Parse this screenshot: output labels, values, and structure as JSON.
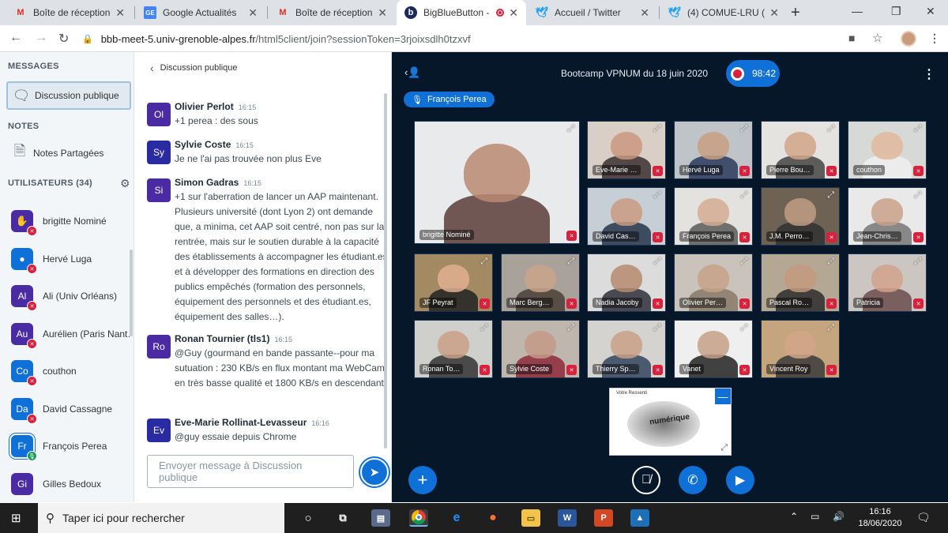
{
  "browser": {
    "tabs": [
      {
        "label": "Boîte de réception (2",
        "icon": "gmail-icon",
        "active": false
      },
      {
        "label": "Google Actualités",
        "icon": "google-news-icon",
        "active": false
      },
      {
        "label": "Boîte de réception (9",
        "icon": "gmail-icon",
        "active": false
      },
      {
        "label": "BigBlueButton -",
        "icon": "bigbluebutton-icon",
        "active": true
      },
      {
        "label": "Accueil / Twitter",
        "icon": "twitter-icon",
        "active": false
      },
      {
        "label": "(4) COMUE-LRU (@C",
        "icon": "twitter-icon",
        "active": false
      }
    ],
    "url_host": "bbb-meet-5.univ-grenoble-alpes.fr",
    "url_path": "/html5client/join?sessionToken=3rjoixsdlh0tzxvf"
  },
  "sidebar": {
    "messages_heading": "MESSAGES",
    "public_chat_label": "Discussion publique",
    "notes_heading": "NOTES",
    "shared_notes_label": "Notes Partagées",
    "users_heading": "UTILISATEURS (34)",
    "users": [
      {
        "initials": "",
        "name": "brigitte Nominé",
        "color": "#4a2ba3",
        "icon": "hand-icon"
      },
      {
        "initials": "",
        "name": "Hervé Luga",
        "color": "#0f70d7",
        "icon": "user-icon"
      },
      {
        "initials": "Al",
        "name": "Ali (Univ Orléans)",
        "color": "#4a2ba3"
      },
      {
        "initials": "Au",
        "name": "Aurélien (Paris Nant…",
        "color": "#4a2ba3"
      },
      {
        "initials": "Co",
        "name": "couthon",
        "color": "#0f70d7"
      },
      {
        "initials": "Da",
        "name": "David Cassagne",
        "color": "#0f70d7"
      },
      {
        "initials": "Fr",
        "name": "François Perea",
        "color": "#0f70d7"
      },
      {
        "initials": "Gi",
        "name": "Gilles Bedoux",
        "color": "#4a2ba3"
      }
    ]
  },
  "chat": {
    "title": "Discussion publique",
    "messages": [
      {
        "initials": "Ol",
        "color": "#4a2ba3",
        "name": "Olivier Perlot",
        "time": "16:15",
        "text": "+1 perea : des sous"
      },
      {
        "initials": "Sy",
        "color": "#2a2ba3",
        "name": "Sylvie Coste",
        "time": "16:15",
        "text": "Je ne l'ai pas trouvée non plus Eve"
      },
      {
        "initials": "Si",
        "color": "#4a2ba3",
        "name": "Simon Gadras",
        "time": "16:15",
        "text": "+1 sur l'aberration de lancer un AAP maintenant. Plusieurs université (dont Lyon 2) ont demande que, a minima, cet AAP soit centré, non pas sur la rentrée, mais sur le soutien durable à la capacité des établissements à accompagner les étudiant.es et à développer des formations en direction des publics empêchés (formation des personnels, équipement des personnels et des étudiant.es, équipement des salles…)."
      },
      {
        "initials": "Ro",
        "color": "#4a2ba3",
        "name": "Ronan Tournier (tls1)",
        "time": "16:15",
        "text": "@Guy (gourmand en bande passante--pour ma sutuation : 230 KB/s en flux montant ma WebCam en très basse qualité et 1800 KB/s en descendant)"
      },
      {
        "initials": "Ev",
        "color": "#2a2ba3",
        "name": "Eve-Marie Rollinat-Levasseur",
        "time": "16:16",
        "text": "@guy essaie depuis Chrome"
      }
    ],
    "input_placeholder": "Envoyer message à Discussion publique"
  },
  "meeting": {
    "title": "Bootcamp VPNUM du 18 juin 2020",
    "recording_time": "98:42",
    "talking_indicator": "François Perea",
    "videos": [
      {
        "name": "brigitte Nominé",
        "bg": "#e9eaec",
        "skin": "#b98a72",
        "shirt": "#5b3d3a"
      },
      {
        "name": "Eve-Marie …",
        "bg": "#d9cfc6",
        "skin": "#c9987f",
        "shirt": "#3a3030"
      },
      {
        "name": "Hervé Luga",
        "bg": "#bfc4c8",
        "skin": "#c8a083",
        "shirt": "#2b3b5c"
      },
      {
        "name": "Pierre Bou…",
        "bg": "#e5e3df",
        "skin": "#d2a58a",
        "shirt": "#444"
      },
      {
        "name": "couthon",
        "bg": "#d7d9d6",
        "skin": "#e1b99c",
        "shirt": "#eee"
      },
      {
        "name": "David Cas…",
        "bg": "#c6ced6",
        "skin": "#c99b80",
        "shirt": "#26354a"
      },
      {
        "name": "François Perea",
        "bg": "#e4e2de",
        "skin": "#d3ab92",
        "shirt": "#5a5a5a"
      },
      {
        "name": "J.M. Perro…",
        "bg": "#6e6254",
        "skin": "#c19e84",
        "shirt": "#333"
      },
      {
        "name": "Jean-Chris…",
        "bg": "#e9e9e9",
        "skin": "#caa189",
        "shirt": "#777"
      },
      {
        "name": "JF Peyrat",
        "bg": "#a48a62",
        "skin": "#e0b092",
        "shirt": "#222"
      },
      {
        "name": "Marc Berg…",
        "bg": "#a8a29a",
        "skin": "#c9a48b",
        "shirt": "#4a4036"
      },
      {
        "name": "Nadia Jacoby",
        "bg": "#dcdcdc",
        "skin": "#b78a6e",
        "shirt": "#2f2f3a"
      },
      {
        "name": "Olivier Per…",
        "bg": "#c9c3bb",
        "skin": "#c7a287",
        "shirt": "#8a7a6a"
      },
      {
        "name": "Pascal Ro…",
        "bg": "#b4a894",
        "skin": "#c39a7c",
        "shirt": "#2d2d2d"
      },
      {
        "name": "Patricia",
        "bg": "#cbc6c1",
        "skin": "#d1a28b",
        "shirt": "#6b4e4e"
      },
      {
        "name": "Ronan To…",
        "bg": "#cfd0cc",
        "skin": "#caa086",
        "shirt": "#333"
      },
      {
        "name": "Sylvie Coste",
        "bg": "#bfb6ae",
        "skin": "#c49a87",
        "shirt": "#8c2a3a"
      },
      {
        "name": "Thierry Sp…",
        "bg": "#d4d3cf",
        "skin": "#c8a086",
        "shirt": "#34445e"
      },
      {
        "name": "Vanet",
        "bg": "#efefef",
        "skin": "#c69f87",
        "shirt": "#222"
      },
      {
        "name": "Vincent Roy",
        "bg": "#c5a57e",
        "skin": "#d1a48a",
        "shirt": "#3a3a3a"
      }
    ],
    "presentation_title": "Votre Ressenti",
    "presentation_word": "numérique"
  },
  "taskbar": {
    "search_placeholder": "Taper ici pour rechercher",
    "time": "16:16",
    "date": "18/06/2020"
  },
  "colors": {
    "accent": "#0f70d7",
    "danger": "#d8213d",
    "meeting_bg": "#06172a"
  }
}
